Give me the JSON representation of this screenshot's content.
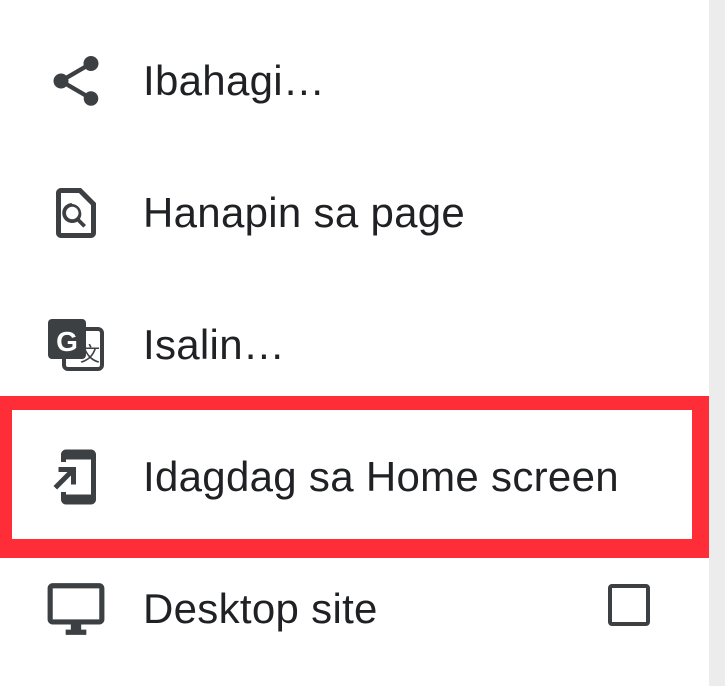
{
  "menu": {
    "items": [
      {
        "label": "Ibahagi…",
        "icon": "share-icon"
      },
      {
        "label": "Hanapin sa page",
        "icon": "find-in-page-icon"
      },
      {
        "label": "Isalin…",
        "icon": "translate-icon"
      },
      {
        "label": "Idagdag sa Home screen",
        "icon": "add-to-home-screen-icon"
      },
      {
        "label": "Desktop site",
        "icon": "desktop-icon",
        "checked": false
      }
    ]
  },
  "colors": {
    "highlight": "#ff2d37",
    "icon": "#3c4043",
    "text": "#202124"
  }
}
